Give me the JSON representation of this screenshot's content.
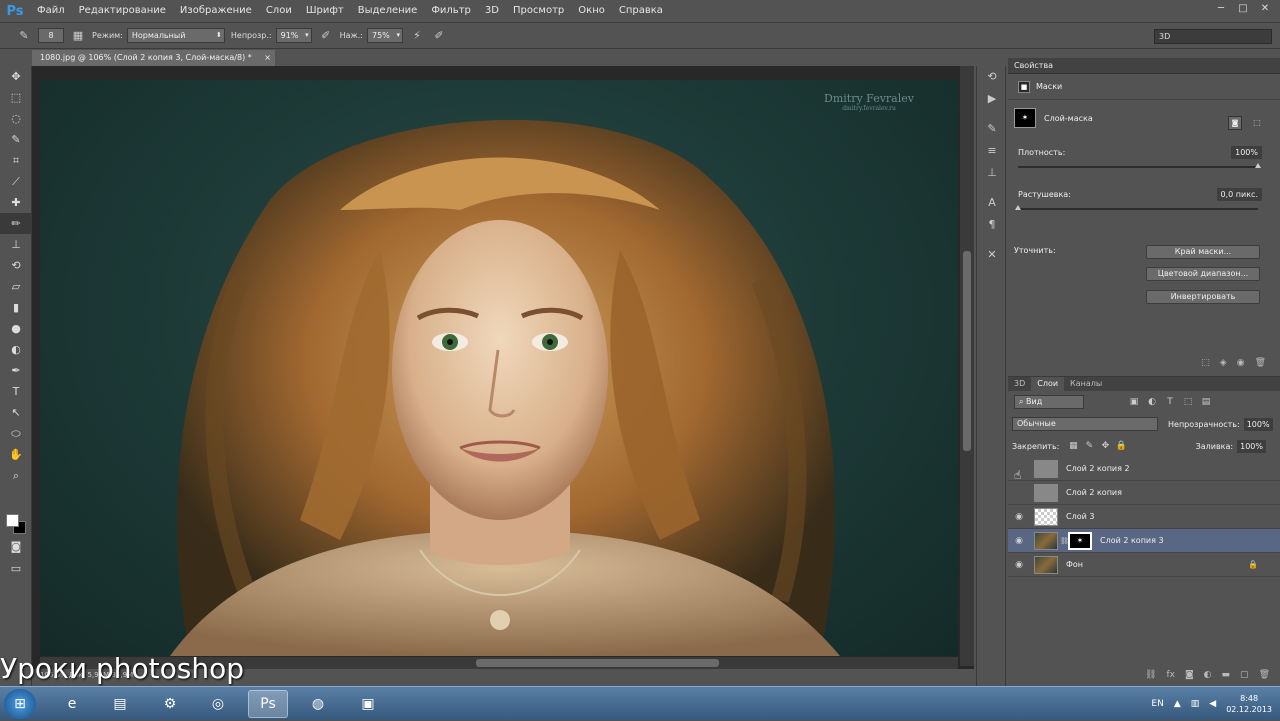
{
  "app": {
    "logo": "Ps"
  },
  "menu": [
    "Файл",
    "Редактирование",
    "Изображение",
    "Слои",
    "Шрифт",
    "Выделение",
    "Фильтр",
    "3D",
    "Просмотр",
    "Окно",
    "Справка"
  ],
  "window_buttons": [
    "─",
    "□",
    "✕"
  ],
  "options": {
    "brush_size": "8",
    "mode_label": "Режим:",
    "mode_value": "Нормальный",
    "opacity_label": "Непрозр.:",
    "opacity_value": "91%",
    "flow_label": "Наж.:",
    "flow_value": "75%",
    "workspace": "3D"
  },
  "document_tab": {
    "title": "1080.jpg @ 106% (Слой 2 копия 3, Слой-маска/8) *",
    "close": "×"
  },
  "watermark": {
    "name": "Dmitry Fevralev",
    "sub": "dmitry.fevralev.ru"
  },
  "status": {
    "text": "106,6%    Док: 5,93M/35,9M"
  },
  "lesson_caption": "Уроки photoshop",
  "properties": {
    "tab": "Свойства",
    "masks_label": "Маски",
    "layer_mask_label": "Слой-маска",
    "density_label": "Плотность:",
    "density_value": "100%",
    "density_level": 1.0,
    "feather_label": "Растушевка:",
    "feather_value": "0,0 пикс.",
    "feather_level": 0.0,
    "refine_label": "Уточнить:",
    "buttons": [
      "Край маски...",
      "Цветовой диапазон...",
      "Инвертировать"
    ]
  },
  "layers_panel": {
    "tabs": [
      "3D",
      "Слои",
      "Каналы"
    ],
    "active_tab": "Слои",
    "filter": "Вид",
    "blend_mode": "Обычные",
    "opacity_label": "Непрозрачность:",
    "opacity_value": "100%",
    "lock_label": "Закрепить:",
    "fill_label": "Заливка:",
    "fill_value": "100%",
    "layers": [
      {
        "name": "Слой 2 копия 2",
        "visible": false,
        "thumb": "gray"
      },
      {
        "name": "Слой 2 копия",
        "visible": false,
        "thumb": "gray"
      },
      {
        "name": "Слой 3",
        "visible": true,
        "thumb": "transparent"
      },
      {
        "name": "Слой 2 копия 3",
        "visible": true,
        "thumb": "photo",
        "mask": true,
        "selected": true
      },
      {
        "name": "Фон",
        "visible": true,
        "thumb": "photo",
        "locked": true
      }
    ]
  },
  "taskbar": {
    "tray_lang": "EN",
    "time": "8:48",
    "date": "02.12.2013"
  }
}
